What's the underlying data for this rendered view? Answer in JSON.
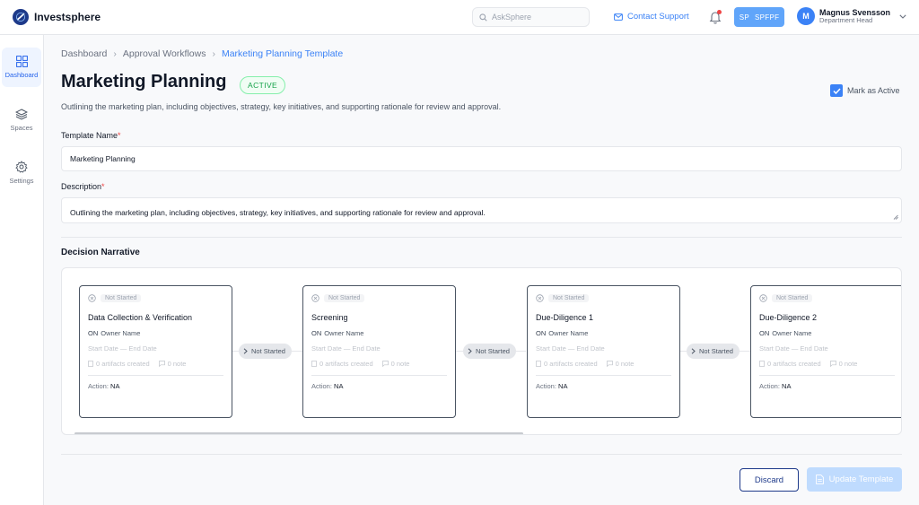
{
  "app": {
    "name": "Investsphere"
  },
  "header": {
    "search_placeholder": "AskSphere",
    "contact_support": "Contact Support",
    "workspace_chip": {
      "initials": "SP",
      "label": "SPFPF"
    },
    "user": {
      "initial": "M",
      "name": "Magnus Svensson",
      "role": "Department Head"
    }
  },
  "sidebar": {
    "items": [
      {
        "label": "Dashboard",
        "icon": "grid-icon",
        "active": true
      },
      {
        "label": "Spaces",
        "icon": "layers-icon",
        "active": false
      },
      {
        "label": "Settings",
        "icon": "gear-icon",
        "active": false
      }
    ]
  },
  "breadcrumb": [
    "Dashboard",
    "Approval Workflows",
    "Marketing Planning Template"
  ],
  "page": {
    "title": "Marketing Planning",
    "status_badge": "ACTIVE",
    "subtitle": "Outlining the marketing plan, including objectives, strategy, key initiatives, and supporting rationale for review and approval.",
    "mark_active_label": "Mark as Active",
    "mark_active_checked": true
  },
  "form": {
    "template_name_label": "Template Name",
    "template_name_value": "Marketing Planning",
    "description_label": "Description",
    "description_value": "Outlining the marketing plan, including objectives, strategy, key initiatives, and supporting rationale for review and approval.",
    "required_marker": "*"
  },
  "decision_narrative": {
    "title": "Decision Narrative",
    "stages": [
      {
        "status": "Not Started",
        "name": "Data Collection & Verification",
        "owner_prefix": "ON",
        "owner": "Owner Name",
        "dates": "Start Date — End Date",
        "artifacts": "0 artifacts created",
        "notes": "0 note",
        "action_label": "Action:",
        "action_value": "NA"
      },
      {
        "status": "Not Started",
        "name": "Screening",
        "owner_prefix": "ON",
        "owner": "Owner Name",
        "dates": "Start Date — End Date",
        "artifacts": "0 artifacts created",
        "notes": "0 note",
        "action_label": "Action:",
        "action_value": "NA"
      },
      {
        "status": "Not Started",
        "name": "Due-Diligence 1",
        "owner_prefix": "ON",
        "owner": "Owner Name",
        "dates": "Start Date — End Date",
        "artifacts": "0 artifacts created",
        "notes": "0 note",
        "action_label": "Action:",
        "action_value": "NA"
      },
      {
        "status": "Not Started",
        "name": "Due-Diligence 2",
        "owner_prefix": "ON",
        "owner": "Owner Name",
        "dates": "Start Date — End Date",
        "artifacts": "0 artifacts created",
        "notes": "0 note",
        "action_label": "Action:",
        "action_value": "NA"
      }
    ],
    "connectors": [
      "Not Started",
      "Not Started",
      "Not Started"
    ]
  },
  "actions": {
    "discard": "Discard",
    "update": "Update Template"
  },
  "colors": {
    "accent": "#3b82f6",
    "brand": "#1e3a8a",
    "active_green": "#16a34a",
    "required_red": "#ef4444"
  }
}
